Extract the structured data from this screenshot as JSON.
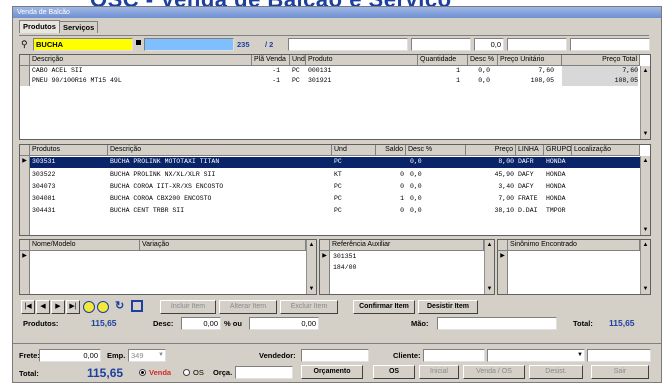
{
  "banner": {
    "title": "OSC - Venda de Balcão e Serviço"
  },
  "window": {
    "title": "Venda de Balcão"
  },
  "tabs": [
    {
      "label": "Produtos"
    },
    {
      "label": "Serviços"
    }
  ],
  "search": {
    "value": "BUCHA",
    "qty": "235",
    "page": "/ 2",
    "price": "0,0"
  },
  "sale_items": {
    "headers": [
      "Descrição",
      "Plã Venda",
      "Und",
      "Produto",
      "Quantidade",
      "Desc %",
      "Preço Unitário",
      "Preço Total"
    ],
    "rows": [
      [
        "CABO ACEL SII",
        "-1",
        "PC",
        "000131",
        "1",
        "0,0",
        "7,60",
        "7,60"
      ],
      [
        "PNEU 90/100R16 MT15 49L",
        "-1",
        "PC",
        "301921",
        "1",
        "0,0",
        "108,05",
        "108,05"
      ]
    ]
  },
  "product_list": {
    "headers": [
      "Produtos",
      "Descrição",
      "Und",
      "Saldo",
      "Desc %",
      "Preço",
      "LINHA",
      "GRUPO",
      "Localização"
    ],
    "rows": [
      [
        "303531",
        "BUCHA PROLINK MOTOTAXI TITAN",
        "PC",
        "",
        "0,0",
        "8,00",
        "DAFR",
        "HONDA",
        ""
      ],
      [
        "303522",
        "BUCHA PROLINK NX/XL/XLR SII",
        "KT",
        "0",
        "0,0",
        "45,90",
        "DAFY",
        "HONDA",
        ""
      ],
      [
        "304073",
        "BUCHA COROA IIT-XR/XS ENCOSTO",
        "PC",
        "0",
        "0,0",
        "3,40",
        "DAFY",
        "HONDA",
        ""
      ],
      [
        "304081",
        "BUCHA COROA CBX200 ENCOSTO",
        "PC",
        "1",
        "0,0",
        "7,00",
        "FRATE",
        "HONDA",
        ""
      ],
      [
        "304431",
        "BUCHA CENT TRBR SII",
        "PC",
        "0",
        "0,0",
        "38,10",
        "D.DAI",
        "TMPOR",
        ""
      ]
    ]
  },
  "sub_grids": {
    "left_headers": [
      "Nome/Modelo",
      "Variação"
    ],
    "ref_header": "Referência Auxiliar",
    "ref_rows": [
      "301351",
      "184/00"
    ],
    "syn_header": "Sinônimo Encontrado"
  },
  "toolbar": {
    "incluir": "Incluir Item",
    "alterar": "Alterar Item",
    "excluir": "Excluir Item",
    "confirmar": "Confirmar Item",
    "desistir": "Desistir Item"
  },
  "summary": {
    "produtos_label": "Produtos:",
    "produtos_value": "115,65",
    "desc_label": "Desc:",
    "desc_value": "0,00",
    "pct_label": "% ou",
    "desc_amount": "0,00",
    "mao_label": "Mão:",
    "total_label": "Total:",
    "total_value": "115,65"
  },
  "footer": {
    "frete_label": "Frete:",
    "frete_value": "0,00",
    "emp_label": "Emp.",
    "emp_value": "349",
    "vendedor_label": "Vendedor:",
    "cliente_label": "Cliente:",
    "total_label": "Total:",
    "total_value": "115,65",
    "venda": "Venda",
    "os": "OS",
    "orca": "Orça.",
    "btn_orcamento": "Orçamento",
    "btn_os": "OS",
    "btn_inicial": "Inicial",
    "btn_venda_os": "Venda / OS",
    "btn_desist": "Desist.",
    "btn_sair": "Sair"
  },
  "colors": {
    "selection": "#0a246a",
    "search_bg": "#ffff00",
    "search2_bg": "#7fbfff",
    "brand": "#1d3f9e"
  }
}
